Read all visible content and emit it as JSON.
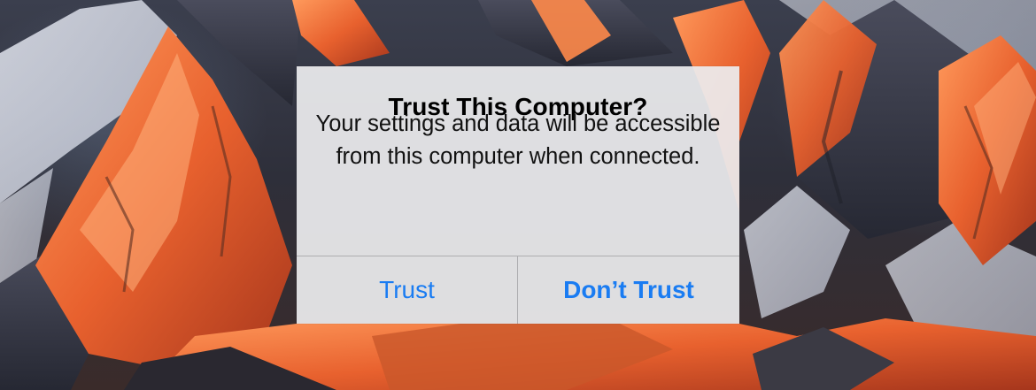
{
  "alert": {
    "title": "Trust This Computer?",
    "message": "Your settings and data will be accessible from this computer when connected.",
    "buttons": {
      "trust_label": "Trust",
      "dont_trust_label": "Don’t Trust"
    }
  },
  "colors": {
    "button_text": "#1a7cf2",
    "alert_background": "#ececee",
    "mountain_highlight": "#f0743a"
  },
  "background": {
    "image": "mountain-wallpaper"
  }
}
